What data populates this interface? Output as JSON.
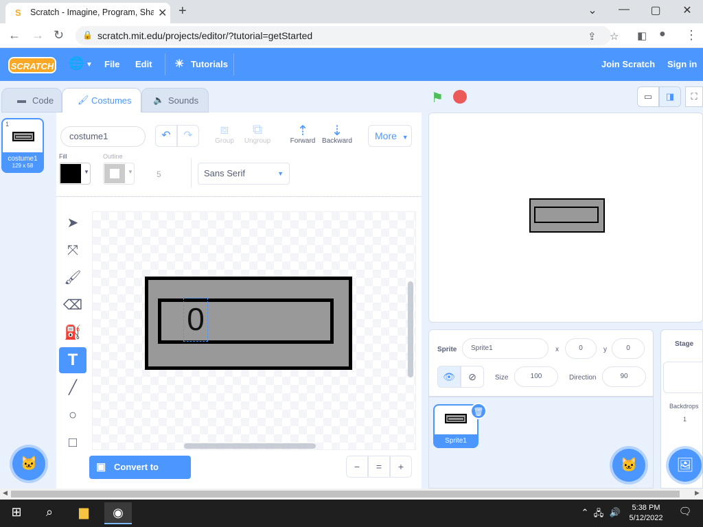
{
  "browser": {
    "tab_title": "Scratch - Imagine, Program, Shar",
    "tab_favicon": "S",
    "url": "scratch.mit.edu/projects/editor/?tutorial=getStarted",
    "window_controls": {
      "minimize": "—",
      "maximize": "▢",
      "close": "✕",
      "tabs_dropdown": "⌄"
    }
  },
  "menubar": {
    "logo": "SCRATCH",
    "file": "File",
    "edit": "Edit",
    "tutorials": "Tutorials",
    "join": "Join Scratch",
    "signin": "Sign in"
  },
  "editor_tabs": {
    "code": "Code",
    "costumes": "Costumes",
    "sounds": "Sounds"
  },
  "costume_list": {
    "items": [
      {
        "index": "1",
        "name": "costume1",
        "size": "129 x 58"
      }
    ]
  },
  "paint": {
    "costume_name": "costume1",
    "group": "Group",
    "ungroup": "Ungroup",
    "forward": "Forward",
    "backward": "Backward",
    "more": "More",
    "fill_label": "Fill",
    "outline_label": "Outline",
    "outline_width": "5",
    "font": "Sans Serif",
    "canvas_text": "0",
    "convert_button": "Convert to Bitmap",
    "zoom_out": "−",
    "zoom_reset": "=",
    "zoom_in": "+",
    "fill_color": "#000000",
    "shape_fill": "#999999"
  },
  "sprite_info": {
    "sprite_label": "Sprite",
    "sprite_name": "Sprite1",
    "x_label": "x",
    "x": "0",
    "y_label": "y",
    "y": "0",
    "size_label": "Size",
    "size": "100",
    "direction_label": "Direction",
    "direction": "90"
  },
  "sprites": [
    {
      "name": "Sprite1"
    }
  ],
  "stage_target": {
    "title": "Stage",
    "backdrops_label": "Backdrops",
    "backdrops_count": "1"
  },
  "taskbar": {
    "time": "5:38 PM",
    "date": "5/12/2022"
  },
  "colors": {
    "scratch_blue": "#4c97ff",
    "green_flag": "#4cbf56",
    "stop": "#ec5959"
  }
}
